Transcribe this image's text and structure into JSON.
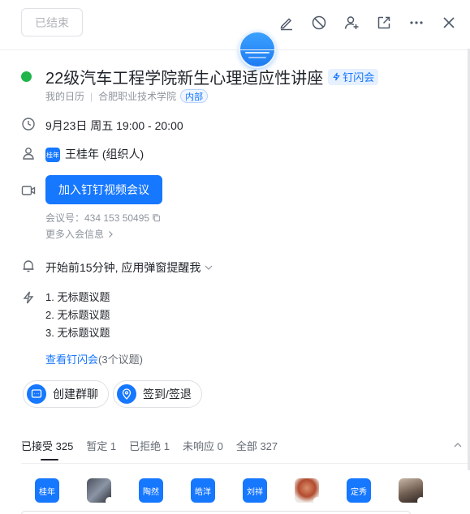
{
  "header": {
    "status_label": "已结束",
    "icons": [
      "edit-icon",
      "cancel-icon",
      "add-person-icon",
      "open-external-icon",
      "more-icon",
      "close-icon"
    ]
  },
  "event": {
    "title": "22级汽车工程学院新生心理适应性讲座",
    "title_tag": "钉闪会",
    "calendar": "我的日历",
    "organization": "合肥职业技术学院",
    "org_tag": "内部",
    "time": "9月23日 周五 19:00 - 20:00",
    "organizer_avatar": "桂年",
    "organizer": "王桂年 (组织人)",
    "status_color": "#1fb54a"
  },
  "meeting": {
    "join_label": "加入钉钉视频会议",
    "id_text": "会议号：434 153 50495",
    "more_label": "更多入会信息"
  },
  "reminder": {
    "text": "开始前15分钟, 应用弹窗提醒我"
  },
  "agenda": {
    "items": [
      "1. 无标题议题",
      "2. 无标题议题",
      "3. 无标题议题"
    ],
    "view_link": "查看钉闪会",
    "view_count": "(3个议题)"
  },
  "actions": {
    "group_chat": "创建群聊",
    "checkin": "签到/签退"
  },
  "tabs": [
    {
      "label": "已接受 325",
      "active": true
    },
    {
      "label": "暂定 1",
      "active": false
    },
    {
      "label": "已拒绝 1",
      "active": false
    },
    {
      "label": "未响应 0",
      "active": false
    },
    {
      "label": "全部 327",
      "active": false
    }
  ],
  "attendees": [
    {
      "label": "桂年",
      "type": "text"
    },
    {
      "label": "",
      "type": "photo1"
    },
    {
      "label": "陶然",
      "type": "text"
    },
    {
      "label": "皓洋",
      "type": "text"
    },
    {
      "label": "刘祥",
      "type": "text"
    },
    {
      "label": "",
      "type": "photo2"
    },
    {
      "label": "定秀",
      "type": "text"
    },
    {
      "label": "",
      "type": "photo3"
    }
  ],
  "colors": {
    "accent": "#1677ff",
    "text": "#1f2329",
    "muted": "#8f959e"
  }
}
